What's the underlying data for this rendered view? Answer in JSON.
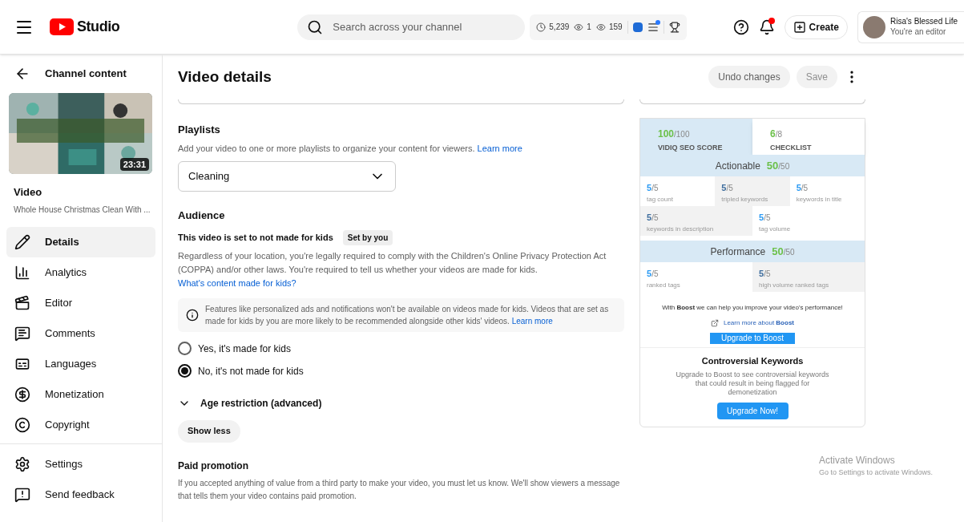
{
  "topbar": {
    "logo": "Studio",
    "search": {
      "placeholder": "Search across your channel"
    },
    "stats": [
      {
        "kind": "clock",
        "value": "5,239"
      },
      {
        "kind": "eye",
        "value": "1"
      },
      {
        "kind": "eye",
        "value": "159"
      }
    ],
    "create": "Create",
    "account": {
      "name": "Risa's Blessed Life",
      "role": "You're an editor"
    }
  },
  "sidebar": {
    "back": "Channel content",
    "video": {
      "duration": "23:31",
      "label": "Video",
      "title": "Whole House Christmas Clean With ..."
    },
    "items": [
      {
        "label": "Details",
        "selected": true
      },
      {
        "label": "Analytics",
        "selected": false
      },
      {
        "label": "Editor",
        "selected": false
      },
      {
        "label": "Comments",
        "selected": false
      },
      {
        "label": "Languages",
        "selected": false
      },
      {
        "label": "Monetization",
        "selected": false
      },
      {
        "label": "Copyright",
        "selected": false
      }
    ],
    "footer": [
      {
        "label": "Settings"
      },
      {
        "label": "Send feedback"
      }
    ]
  },
  "header": {
    "title": "Video details",
    "undo": "Undo changes",
    "save": "Save"
  },
  "playlists": {
    "title": "Playlists",
    "text": "Add your video to one or more playlists to organize your content for viewers.",
    "link": "Learn more",
    "value": "Cleaning"
  },
  "audience": {
    "title": "Audience",
    "status": "This video is set to not made for kids",
    "badge": "Set by you",
    "text": "Regardless of your location, you're legally required to comply with the Children's Online Privacy Protection Act (COPPA) and/or other laws. You're required to tell us whether your videos are made for kids.",
    "link": "What's content made for kids?",
    "note": "Features like personalized ads and notifications won't be available on videos made for kids. Videos that are set as made for kids by you are more likely to be recommended alongside other kids' videos.",
    "note_link": "Learn more",
    "options": [
      {
        "label": "Yes, it's made for kids",
        "selected": false
      },
      {
        "label": "No, it's not made for kids",
        "selected": true
      }
    ],
    "age_restriction": {
      "label": "Age restriction (advanced)",
      "expanded": false
    },
    "show_less": "Show less"
  },
  "paid_promotion": {
    "title": "Paid promotion",
    "text": "If you accepted anything of value from a third party to make your video, you must let us know. We'll show viewers a message that tells them your video contains paid promotion."
  },
  "vidiq": {
    "tabs": [
      {
        "score": "100",
        "max": "/100",
        "label": "VIDIQ SEO SCORE",
        "selected": true
      },
      {
        "score": "6",
        "max": "/8",
        "label": "CHECKLIST",
        "selected": false
      }
    ],
    "sections": [
      {
        "title": "Actionable",
        "score": "50",
        "max": "/50",
        "rows": [
          [
            {
              "score": "5",
              "max": "/5",
              "label": "tag count",
              "shaded": false
            },
            {
              "score": "5",
              "max": "/5",
              "label": "tripled keywords",
              "shaded": true
            },
            {
              "score": "5",
              "max": "/5",
              "label": "keywords in title",
              "shaded": false
            }
          ],
          [
            {
              "score": "5",
              "max": "/5",
              "label": "keywords in description",
              "shaded": true
            },
            {
              "score": "5",
              "max": "/5",
              "label": "tag volume",
              "shaded": false
            }
          ]
        ]
      },
      {
        "title": "Performance",
        "score": "50",
        "max": "/50",
        "rows": [
          [
            {
              "score": "5",
              "max": "/5",
              "label": "ranked tags",
              "shaded": false
            },
            {
              "score": "5",
              "max": "/5",
              "label": "high volume ranked tags",
              "shaded": true
            }
          ]
        ]
      }
    ],
    "boost_text": "With **Boost** we can help you improve your video's performance!",
    "boost_link": "Learn more about **Boost**",
    "boost_button": "Upgrade to Boost",
    "controversial": {
      "title": "Controversial Keywords",
      "text": "Upgrade to Boost to see controversial keywords that could result in being flagged for demonetization",
      "button": "Upgrade Now!"
    }
  },
  "activation": {
    "title": "Activate Windows",
    "text": "Go to Settings to activate Windows."
  }
}
